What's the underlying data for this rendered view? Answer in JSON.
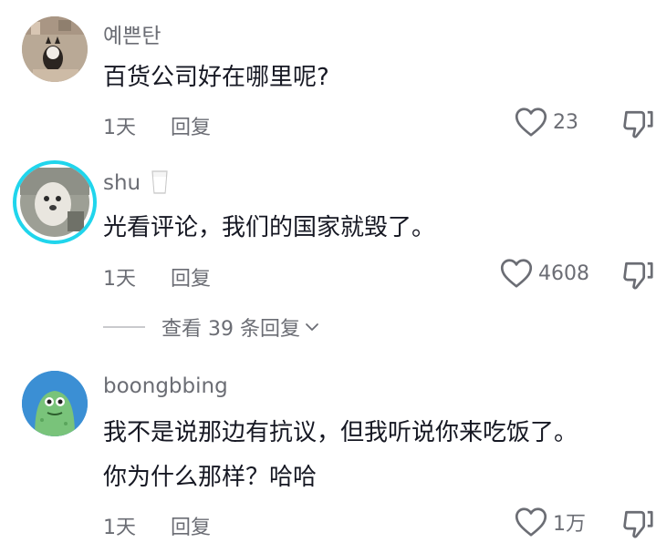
{
  "comments": [
    {
      "username": "예쁜탄",
      "text": "百货公司好在哪里呢?",
      "time": "1天",
      "reply_label": "回复",
      "likes": "23"
    },
    {
      "username": "shu",
      "username_emoji": "🥛",
      "text": "光看评论，我们的国家就毁了。",
      "time": "1天",
      "reply_label": "回复",
      "likes": "4608"
    },
    {
      "username": "boongbbing",
      "text_line1": "我不是说那边有抗议，但我听说你来吃饭了。",
      "text_line2": "你为什么那样？哈哈",
      "time": "1天",
      "reply_label": "回复",
      "likes": "1万"
    }
  ],
  "view_replies": {
    "label": "查看 39 条回复"
  },
  "colors": {
    "text": "#161823",
    "secondary": "#6b6d74",
    "story_ring": "#20d5ec",
    "avatar3": "#3b8fd4"
  },
  "icons": [
    "heart-icon",
    "thumbs-down-icon",
    "chevron-down-icon"
  ]
}
